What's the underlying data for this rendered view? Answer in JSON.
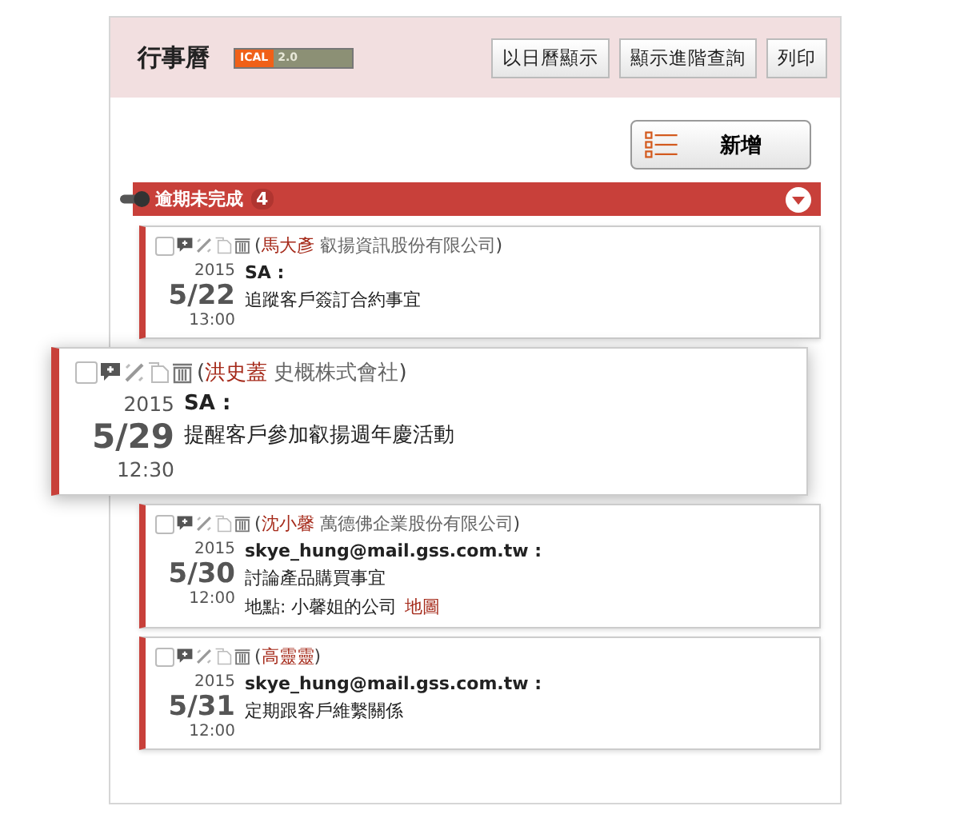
{
  "header": {
    "title": "行事曆",
    "badge": {
      "label": "ICAL",
      "version": "2.0"
    },
    "buttons": [
      "以日曆顯示",
      "顯示進階查詢",
      "列印"
    ]
  },
  "add_button": "新增",
  "section": {
    "title": "逾期未完成",
    "count": "4",
    "expanded": true
  },
  "events": [
    {
      "checked": false,
      "highlighted": false,
      "open": "(",
      "contact": "馬大彥",
      "company": "叡揚資訊股份有限公司",
      "close": ")",
      "year": "2015",
      "date": "5/22",
      "time": "13:00",
      "author": "SA :",
      "lines": [
        "追蹤客戶簽訂合約事宜"
      ]
    },
    {
      "checked": false,
      "highlighted": true,
      "open": "(",
      "contact": "洪史蓋",
      "company": "史概株式會社",
      "close": ")",
      "year": "2015",
      "date": "5/29",
      "time": "12:30",
      "author": "SA :",
      "lines": [
        "提醒客戶參加叡揚週年慶活動"
      ]
    },
    {
      "checked": false,
      "highlighted": false,
      "open": "(",
      "contact": "沈小馨",
      "company": "萬德佛企業股份有限公司",
      "close": ")",
      "year": "2015",
      "date": "5/30",
      "time": "12:00",
      "author": "skye_hung@mail.gss.com.tw :",
      "lines": [
        "討論產品購買事宜"
      ],
      "location": {
        "text": "地點: 小馨姐的公司",
        "link": "地圖"
      }
    },
    {
      "checked": false,
      "highlighted": false,
      "open": "(",
      "contact": "高靈靈",
      "close": ")",
      "year": "2015",
      "date": "5/31",
      "time": "12:00",
      "author": "skye_hung@mail.gss.com.tw :",
      "lines": [
        "定期跟客戶維繫關係"
      ]
    }
  ]
}
